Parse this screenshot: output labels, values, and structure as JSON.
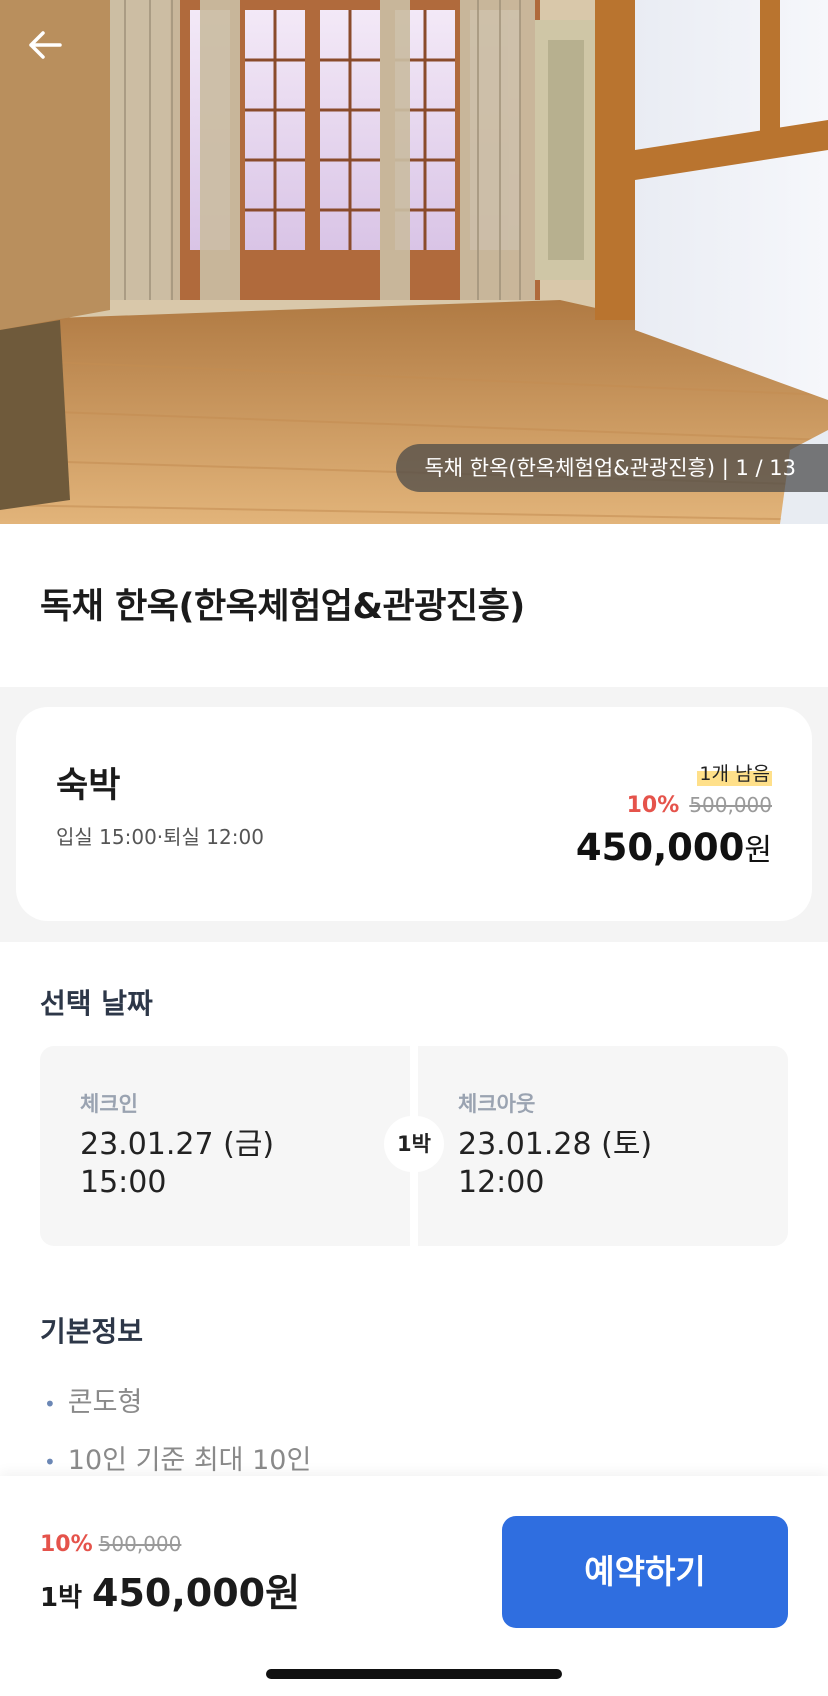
{
  "hero": {
    "caption": "독채  한옥(한옥체험업&관광진흥) | 1 / 13",
    "back_icon": "arrow-left-icon"
  },
  "room": {
    "title": "독채  한옥(한옥체험업&관광진흥)"
  },
  "offer": {
    "name": "숙박",
    "times": "입실 15:00·퇴실 12:00",
    "stock": "1개 남음",
    "discount": "10%",
    "original_price": "500,000",
    "price": "450,000",
    "currency": "원"
  },
  "dates": {
    "section_title": "선택 날짜",
    "checkin_label": "체크인",
    "checkin_date": "23.01.27 (금)",
    "checkin_time": "15:00",
    "nights": "1박",
    "checkout_label": "체크아웃",
    "checkout_date": "23.01.28 (토)",
    "checkout_time": "12:00"
  },
  "info": {
    "section_title": "기본정보",
    "items": [
      "콘도형",
      "10인 기준 최대 10인"
    ]
  },
  "bottom": {
    "discount": "10%",
    "original_price": "500,000",
    "nights": "1박",
    "price": "450,000원",
    "reserve_label": "예약하기"
  },
  "colors": {
    "accent": "#2f6ee0",
    "discount": "#e5534b",
    "badge": "#ffe08a"
  }
}
